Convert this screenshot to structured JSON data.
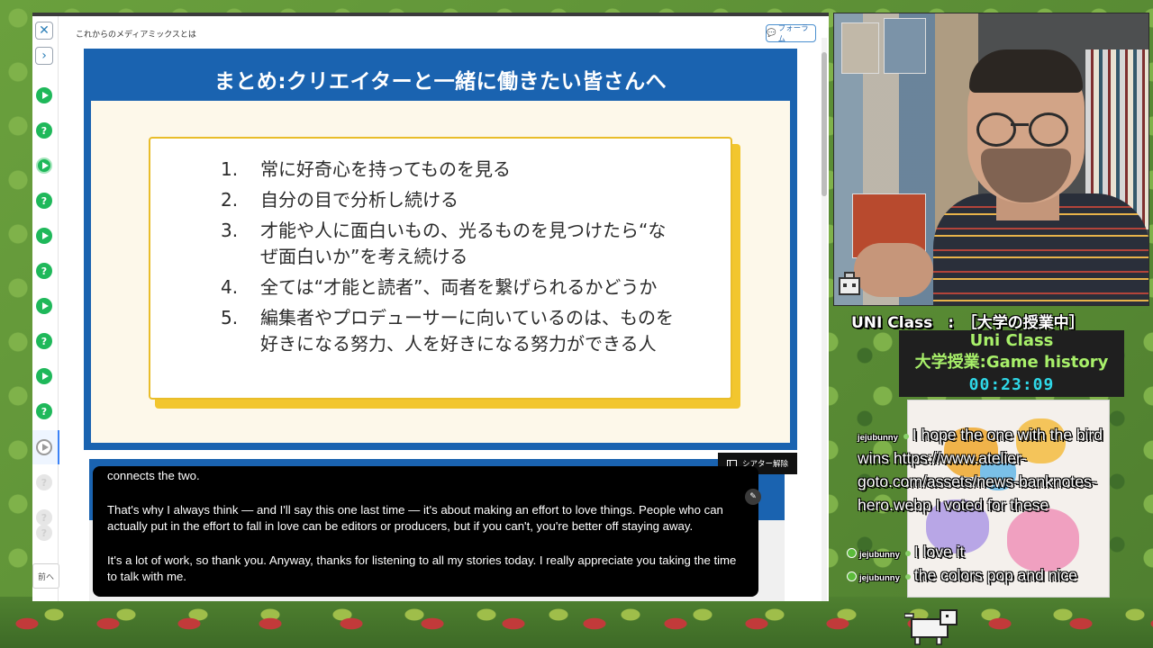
{
  "course_window": {
    "page_title": "これからのメディアミックスとは",
    "forum_button": "フォーラム",
    "prev_button": "前へ",
    "theater_button": "シアター解除",
    "rail_items": [
      "play",
      "question",
      "play-outline",
      "question",
      "play",
      "question",
      "play",
      "question",
      "play",
      "question",
      "current",
      "locked",
      "locked",
      "locked"
    ]
  },
  "slide": {
    "title": "まとめ:クリエイターと一緒に働きたい皆さんへ",
    "items": [
      {
        "num": "1.",
        "text": "常に好奇心を持ってものを見る"
      },
      {
        "num": "2.",
        "text": "自分の目で分析し続ける"
      },
      {
        "num": "3.",
        "text": "才能や人に面白いもの、光るものを見つけたら“なぜ面白いか”を考え続ける"
      },
      {
        "num": "4.",
        "text": "全ては“才能と読者”、両者を繋げられるかどうか"
      },
      {
        "num": "5.",
        "text": "編集者やプロデューサーに向いているのは、ものを好きになる努力、人を好きになる努力ができる人"
      }
    ]
  },
  "subtitles": {
    "line1": "connects the two.",
    "line2": "That's why I always think — and I'll say this one last time — it's about making an effort to love things. People who can actually put in the effort to fall in love can be editors or producers, but if you can't, you're better off staying away.",
    "line3": "It's a lot of work, so thank you. Anyway, thanks for listening to all my stories today. I really appreciate you taking the time to talk with me."
  },
  "stream": {
    "title": "UNI Class　:　［大学の授業中］",
    "info_line1": "Uni Class",
    "info_line2": "大学授業:Game history",
    "timer": "00:23:09"
  },
  "chat": [
    {
      "user": "jejubunny",
      "text": "I hope the one with the bird wins https://www.atelier-goto.com/assets/news-banknotes-hero.webp I voted for these"
    },
    {
      "user": "jejubunny",
      "text": "I love it"
    },
    {
      "user": "jejubunny",
      "text": "the colors pop and nice"
    }
  ],
  "colors": {
    "slide_blue": "#1a63b0",
    "card_yellow": "#f2c62e",
    "success_green": "#1fb85a",
    "timer_cyan": "#2fd8e8",
    "info_green": "#a8f06a"
  }
}
